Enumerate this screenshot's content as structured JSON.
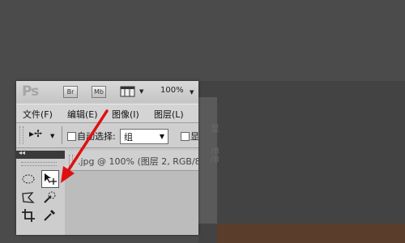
{
  "app": {
    "logo": "Ps",
    "bridge_button": "Br",
    "minibridge_button": "Mb",
    "zoom": "100%"
  },
  "menu": {
    "items": [
      "文件(F)",
      "编辑(E)",
      "图像(I)",
      "图层(L)"
    ]
  },
  "options": {
    "auto_select_label": "自动选择:",
    "auto_select_value": "组",
    "show_label_partial": "显"
  },
  "document": {
    "tab_title": ".jpg @ 100% (图层 2, RGB/8"
  },
  "background_ghost": {
    "text1": "显",
    "text2": "/8",
    "text3": "/8"
  },
  "tools": {
    "marquee_icon": "marquee-ellipse-icon",
    "move_icon": "move-tool-icon",
    "lasso_icon": "polygon-lasso-icon",
    "quick_select_icon": "quick-selection-icon",
    "crop_icon": "crop-icon",
    "eyedropper_icon": "eyedropper-icon"
  },
  "colors": {
    "annotation_arrow": "#e01010"
  }
}
